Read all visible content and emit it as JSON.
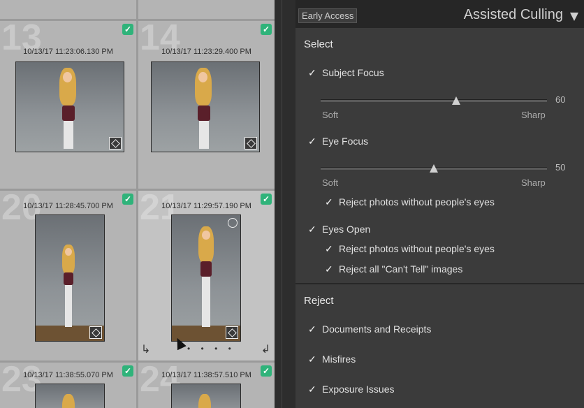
{
  "grid": {
    "cells": [
      {
        "number": "13",
        "timestamp": "10/13/17 11:23:06.130 PM"
      },
      {
        "number": "14",
        "timestamp": "10/13/17 11:23:29.400 PM"
      },
      {
        "number": "20",
        "timestamp": "10/13/17 11:28:45.700 PM"
      },
      {
        "number": "21",
        "timestamp": "10/13/17 11:29:57.190 PM"
      },
      {
        "number": "23",
        "timestamp": "10/13/17 11:38:55.070 PM"
      },
      {
        "number": "24",
        "timestamp": "10/13/17 11:38:57.510 PM"
      }
    ],
    "dots": "• • • •"
  },
  "panel": {
    "early_access": "Early Access",
    "title": "Assisted Culling",
    "select": {
      "heading": "Select",
      "subject_focus": {
        "label": "Subject Focus",
        "value": "60",
        "value_num": 60,
        "min_label": "Soft",
        "max_label": "Sharp"
      },
      "eye_focus": {
        "label": "Eye Focus",
        "value": "50",
        "value_num": 50,
        "min_label": "Soft",
        "max_label": "Sharp",
        "reject_label": "Reject photos without people's eyes"
      },
      "eyes_open": {
        "label": "Eyes Open",
        "reject_no_eyes": "Reject photos without people's eyes",
        "reject_cant_tell": "Reject all \"Can't Tell\" images"
      }
    },
    "reject": {
      "heading": "Reject",
      "items": [
        "Documents and Receipts",
        "Misfires",
        "Exposure Issues"
      ]
    }
  },
  "colors": {
    "accent_check": "#2fb37a",
    "panel_bg": "#3b3b3b",
    "header_bg": "#262626"
  }
}
